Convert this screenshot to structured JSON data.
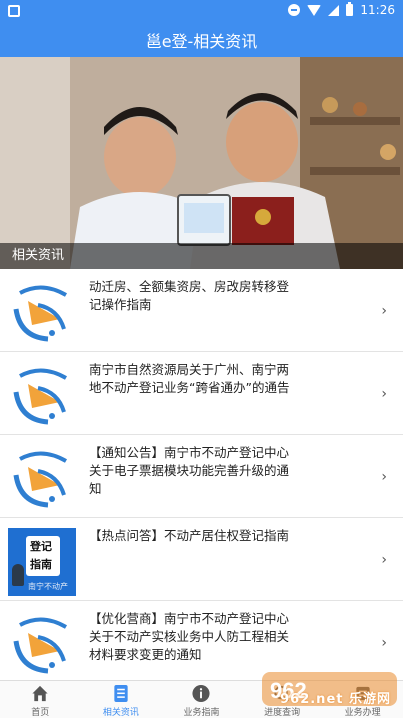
{
  "status_bar": {
    "time": "11:26"
  },
  "header": {
    "title": "邕e登-相关资讯"
  },
  "banner": {
    "caption": "相关资讯"
  },
  "news": [
    {
      "title": "动迁房、全额集资房、房改房转移登记操作指南",
      "thumb": "logo-icon"
    },
    {
      "title": "南宁市自然资源局关于广州、南宁两地不动产登记业务“跨省通办”的通告",
      "thumb": "logo-icon"
    },
    {
      "title": "【通知公告】南宁市不动产登记中心关于电子票据模块功能完善升级的通知",
      "thumb": "logo-icon"
    },
    {
      "title": "【热点问答】不动产居住权登记指南",
      "thumb": "guide-icon",
      "thumb_text_1": "登记",
      "thumb_text_2": "指南",
      "thumb_text_3": "南宁不动产"
    },
    {
      "title": "【优化营商】南宁市不动产登记中心关于不动产实核业务中人防工程相关材料要求变更的通知",
      "thumb": "logo-icon"
    }
  ],
  "tabs": [
    {
      "label": "首页",
      "icon": "home-icon"
    },
    {
      "label": "相关资讯",
      "icon": "news-icon",
      "active": true
    },
    {
      "label": "业务指南",
      "icon": "info-icon"
    },
    {
      "label": "进度查询",
      "icon": "progress-icon"
    },
    {
      "label": "业务办理",
      "icon": "business-icon"
    }
  ],
  "watermark": {
    "text": "962.net 乐游网"
  },
  "colors": {
    "primary": "#3f8ef0",
    "logo_blue": "#2f7fd1",
    "logo_orange": "#f2a33a"
  }
}
